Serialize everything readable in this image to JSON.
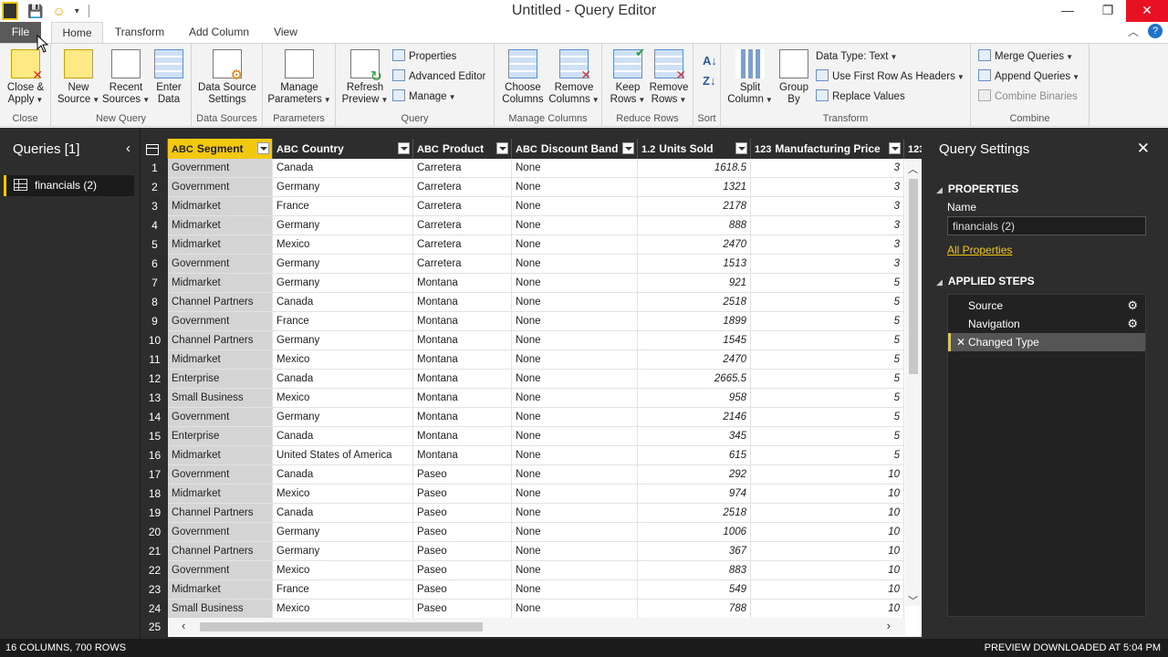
{
  "window": {
    "title": "Untitled - Query Editor",
    "minimize": "—",
    "restore": "❐",
    "close": "✕"
  },
  "menu_tabs": [
    "File",
    "Home",
    "Transform",
    "Add Column",
    "View"
  ],
  "ribbon": {
    "groups": {
      "close": "Close",
      "new_query": "New Query",
      "data_sources": "Data Sources",
      "parameters": "Parameters",
      "query": "Query",
      "manage_columns": "Manage Columns",
      "reduce_rows": "Reduce Rows",
      "sort": "Sort",
      "transform": "Transform",
      "combine": "Combine"
    },
    "buttons": {
      "close_apply": [
        "Close &",
        "Apply"
      ],
      "new_source": [
        "New",
        "Source"
      ],
      "recent_sources": [
        "Recent",
        "Sources"
      ],
      "enter_data": [
        "Enter",
        "Data"
      ],
      "data_source_settings": [
        "Data Source",
        "Settings"
      ],
      "manage_parameters": [
        "Manage",
        "Parameters"
      ],
      "refresh_preview": [
        "Refresh",
        "Preview"
      ],
      "properties": "Properties",
      "advanced_editor": "Advanced Editor",
      "manage": "Manage",
      "choose_columns": [
        "Choose",
        "Columns"
      ],
      "remove_columns": [
        "Remove",
        "Columns"
      ],
      "keep_rows": [
        "Keep",
        "Rows"
      ],
      "remove_rows": [
        "Remove",
        "Rows"
      ],
      "split_column": [
        "Split",
        "Column"
      ],
      "group_by": [
        "Group",
        "By"
      ],
      "data_type": "Data Type: Text",
      "use_first_row": "Use First Row As Headers",
      "replace_values": "Replace Values",
      "merge_queries": "Merge Queries",
      "append_queries": "Append Queries",
      "combine_binaries": "Combine Binaries"
    }
  },
  "queries_pane": {
    "title": "Queries [1]",
    "items": [
      "financials (2)"
    ]
  },
  "grid": {
    "columns": [
      {
        "type": "ABC",
        "name": "Segment"
      },
      {
        "type": "ABC",
        "name": "Country"
      },
      {
        "type": "ABC",
        "name": "Product"
      },
      {
        "type": "ABC",
        "name": "Discount Band"
      },
      {
        "type": "1.2",
        "name": "Units Sold"
      },
      {
        "type": "123",
        "name": "Manufacturing Price"
      },
      {
        "type": "123",
        "name": ""
      }
    ],
    "rows": [
      {
        "n": "1",
        "segment": "Government",
        "country": "Canada",
        "product": "Carretera",
        "discount": "None",
        "units": "1618.5",
        "price": "3"
      },
      {
        "n": "2",
        "segment": "Government",
        "country": "Germany",
        "product": "Carretera",
        "discount": "None",
        "units": "1321",
        "price": "3"
      },
      {
        "n": "3",
        "segment": "Midmarket",
        "country": "France",
        "product": "Carretera",
        "discount": "None",
        "units": "2178",
        "price": "3"
      },
      {
        "n": "4",
        "segment": "Midmarket",
        "country": "Germany",
        "product": "Carretera",
        "discount": "None",
        "units": "888",
        "price": "3"
      },
      {
        "n": "5",
        "segment": "Midmarket",
        "country": "Mexico",
        "product": "Carretera",
        "discount": "None",
        "units": "2470",
        "price": "3"
      },
      {
        "n": "6",
        "segment": "Government",
        "country": "Germany",
        "product": "Carretera",
        "discount": "None",
        "units": "1513",
        "price": "3"
      },
      {
        "n": "7",
        "segment": "Midmarket",
        "country": "Germany",
        "product": "Montana",
        "discount": "None",
        "units": "921",
        "price": "5"
      },
      {
        "n": "8",
        "segment": "Channel Partners",
        "country": "Canada",
        "product": "Montana",
        "discount": "None",
        "units": "2518",
        "price": "5"
      },
      {
        "n": "9",
        "segment": "Government",
        "country": "France",
        "product": "Montana",
        "discount": "None",
        "units": "1899",
        "price": "5"
      },
      {
        "n": "10",
        "segment": "Channel Partners",
        "country": "Germany",
        "product": "Montana",
        "discount": "None",
        "units": "1545",
        "price": "5"
      },
      {
        "n": "11",
        "segment": "Midmarket",
        "country": "Mexico",
        "product": "Montana",
        "discount": "None",
        "units": "2470",
        "price": "5"
      },
      {
        "n": "12",
        "segment": "Enterprise",
        "country": "Canada",
        "product": "Montana",
        "discount": "None",
        "units": "2665.5",
        "price": "5"
      },
      {
        "n": "13",
        "segment": "Small Business",
        "country": "Mexico",
        "product": "Montana",
        "discount": "None",
        "units": "958",
        "price": "5"
      },
      {
        "n": "14",
        "segment": "Government",
        "country": "Germany",
        "product": "Montana",
        "discount": "None",
        "units": "2146",
        "price": "5"
      },
      {
        "n": "15",
        "segment": "Enterprise",
        "country": "Canada",
        "product": "Montana",
        "discount": "None",
        "units": "345",
        "price": "5"
      },
      {
        "n": "16",
        "segment": "Midmarket",
        "country": "United States of America",
        "product": "Montana",
        "discount": "None",
        "units": "615",
        "price": "5"
      },
      {
        "n": "17",
        "segment": "Government",
        "country": "Canada",
        "product": "Paseo",
        "discount": "None",
        "units": "292",
        "price": "10"
      },
      {
        "n": "18",
        "segment": "Midmarket",
        "country": "Mexico",
        "product": "Paseo",
        "discount": "None",
        "units": "974",
        "price": "10"
      },
      {
        "n": "19",
        "segment": "Channel Partners",
        "country": "Canada",
        "product": "Paseo",
        "discount": "None",
        "units": "2518",
        "price": "10"
      },
      {
        "n": "20",
        "segment": "Government",
        "country": "Germany",
        "product": "Paseo",
        "discount": "None",
        "units": "1006",
        "price": "10"
      },
      {
        "n": "21",
        "segment": "Channel Partners",
        "country": "Germany",
        "product": "Paseo",
        "discount": "None",
        "units": "367",
        "price": "10"
      },
      {
        "n": "22",
        "segment": "Government",
        "country": "Mexico",
        "product": "Paseo",
        "discount": "None",
        "units": "883",
        "price": "10"
      },
      {
        "n": "23",
        "segment": "Midmarket",
        "country": "France",
        "product": "Paseo",
        "discount": "None",
        "units": "549",
        "price": "10"
      },
      {
        "n": "24",
        "segment": "Small Business",
        "country": "Mexico",
        "product": "Paseo",
        "discount": "None",
        "units": "788",
        "price": "10"
      }
    ],
    "last_row_number": "25"
  },
  "settings": {
    "title": "Query Settings",
    "properties_title": "PROPERTIES",
    "name_label": "Name",
    "name_value": "financials (2)",
    "all_properties": "All Properties",
    "applied_steps_title": "APPLIED STEPS",
    "steps": [
      "Source",
      "Navigation",
      "Changed Type"
    ]
  },
  "status": {
    "left": "16 COLUMNS, 700 ROWS",
    "right": "PREVIEW DOWNLOADED AT 5:04 PM"
  },
  "colors": {
    "accent": "#f2c811",
    "dark": "#2d2d2d",
    "close_red": "#e81123"
  }
}
